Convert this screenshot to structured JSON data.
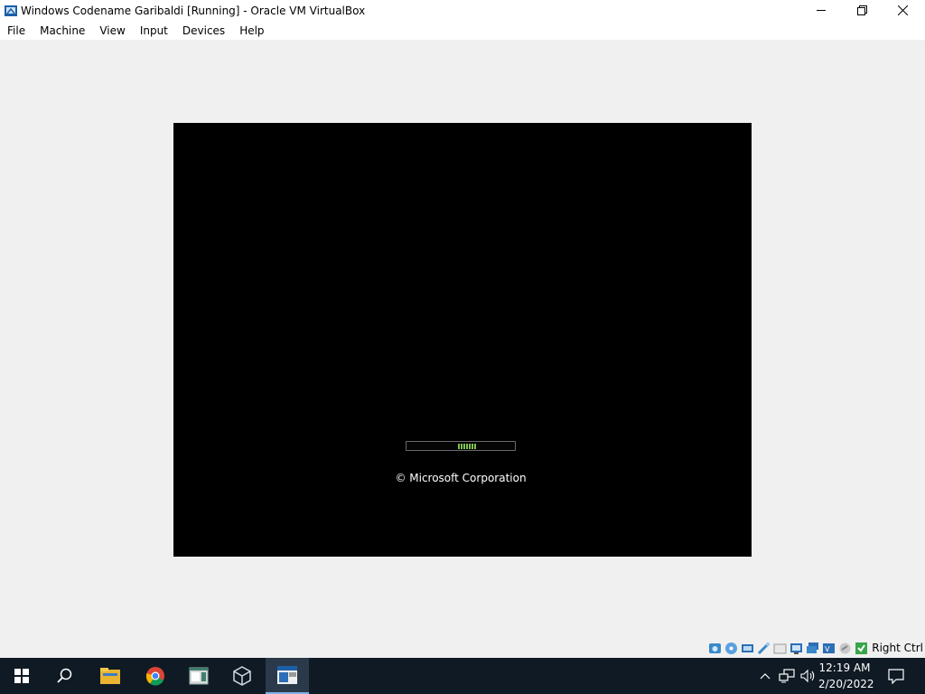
{
  "window": {
    "title": "Windows Codename Garibaldi [Running] - Oracle VM VirtualBox",
    "controls": {
      "minimize_icon": "minimize-icon",
      "restore_icon": "restore-icon",
      "close_icon": "close-icon"
    }
  },
  "menu": {
    "items": [
      {
        "label": "File"
      },
      {
        "label": "Machine"
      },
      {
        "label": "View"
      },
      {
        "label": "Input"
      },
      {
        "label": "Devices"
      },
      {
        "label": "Help"
      }
    ]
  },
  "vm": {
    "copyright": "© Microsoft Corporation",
    "boot_progress_color": "#7fc24f"
  },
  "statusbar": {
    "icons": [
      "hard-disk-icon",
      "optical-drive-icon",
      "audio-icon",
      "network-icon",
      "usb-icon",
      "shared-folders-icon",
      "display-icon",
      "video-capture-icon",
      "cpu-icon",
      "mouse-integration-icon",
      "keyboard-icon"
    ],
    "host_key": "Right Ctrl"
  },
  "taskbar": {
    "apps": [
      "start-icon",
      "search-icon",
      "file-explorer-icon",
      "chrome-icon",
      "window-app-icon",
      "virtualbox-icon",
      "vm-window-icon"
    ],
    "clock": {
      "time": "12:19 AM",
      "date": "2/20/2022"
    },
    "tray_icons": [
      "chevron-up-icon",
      "network-icon",
      "volume-icon",
      "notification-icon"
    ]
  }
}
